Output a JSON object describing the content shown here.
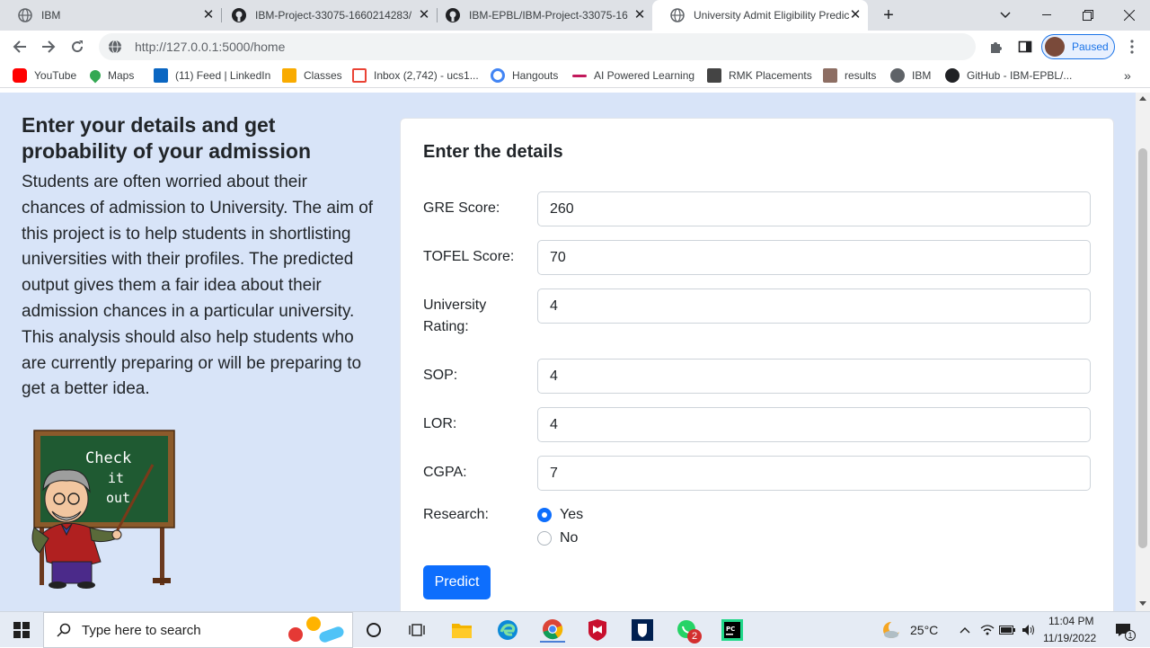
{
  "browser": {
    "tabs": [
      {
        "title": "IBM",
        "active": false
      },
      {
        "title": "IBM-Project-33075-1660214283/",
        "active": false
      },
      {
        "title": "IBM-EPBL/IBM-Project-33075-16",
        "active": false
      },
      {
        "title": "University Admit Eligibility Predic",
        "active": true
      }
    ],
    "url_host": "http://127.0.0.1",
    "url_path": ":5000/home",
    "profile_label": "Paused",
    "bookmarks": [
      {
        "label": "YouTube",
        "icon": "youtube-icon",
        "color": "#ff0000"
      },
      {
        "label": "Maps",
        "icon": "maps-pin-icon",
        "color": "#34a853"
      },
      {
        "label": "(11) Feed | LinkedIn",
        "icon": "linkedin-icon",
        "color": "#0a66c2"
      },
      {
        "label": "Classes",
        "icon": "classroom-icon",
        "color": "#f9ab00"
      },
      {
        "label": "Inbox (2,742) - ucs1...",
        "icon": "gmail-icon",
        "color": "#ea4335"
      },
      {
        "label": "Hangouts",
        "icon": "google-g-icon",
        "color": "#4285f4"
      },
      {
        "label": "AI Powered Learning",
        "icon": "ai-learning-icon",
        "color": "#c2185b"
      },
      {
        "label": "RMK Placements",
        "icon": "rmk-icon",
        "color": "#444444"
      },
      {
        "label": "results",
        "icon": "results-icon",
        "color": "#8d6e63"
      },
      {
        "label": "IBM",
        "icon": "globe-icon",
        "color": "#5f6368"
      },
      {
        "label": "GitHub - IBM-EPBL/...",
        "icon": "github-icon",
        "color": "#202124"
      }
    ]
  },
  "page": {
    "heading": "Enter your details and get probability of your admission",
    "description": "Students are often worried about their chances of admission to University. The aim of this project is to help students in shortlisting universities with their profiles. The predicted output gives them a fair idea about their admission chances in a particular university. This analysis should also help students who are currently preparing or will be preparing to get a better idea.",
    "board_text": [
      "Check",
      "it",
      "out"
    ],
    "form": {
      "title": "Enter the details",
      "fields": [
        {
          "label": "GRE Score:",
          "value": "260"
        },
        {
          "label": "TOFEL Score:",
          "value": "70"
        },
        {
          "label": "University Rating:",
          "value": "4"
        },
        {
          "label": "SOP:",
          "value": "4"
        },
        {
          "label": "LOR:",
          "value": "4"
        },
        {
          "label": "CGPA:",
          "value": "7"
        }
      ],
      "research_label": "Research:",
      "research_options": [
        {
          "label": "Yes",
          "checked": true
        },
        {
          "label": "No",
          "checked": false
        }
      ],
      "submit_label": "Predict"
    }
  },
  "taskbar": {
    "search_placeholder": "Type here to search",
    "temperature": "25°C",
    "time": "11:04 PM",
    "date": "11/19/2022",
    "whatsapp_badge": "2",
    "notification_count": "1"
  },
  "colors": {
    "page_bg": "#d8e4f8",
    "primary_button": "#0d6efd"
  }
}
